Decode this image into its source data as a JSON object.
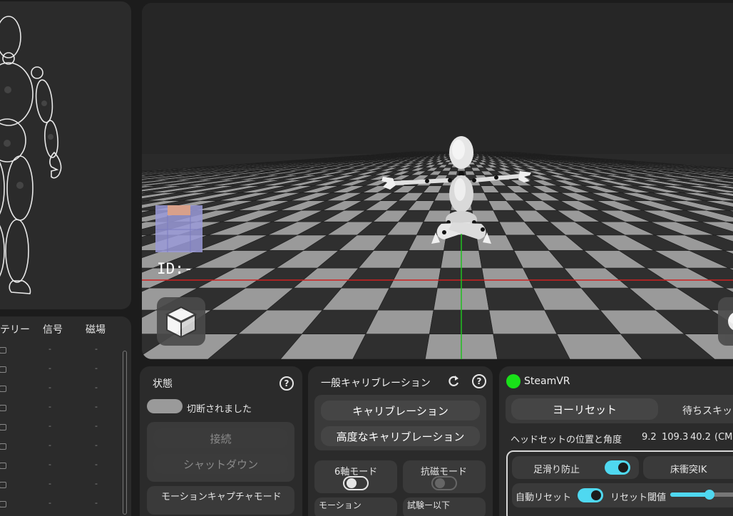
{
  "viewport": {
    "id_label": "ID:-",
    "grid_dark": "#2f2f2f",
    "grid_light": "#9a9a9a",
    "x_axis_color": "#d02020",
    "z_axis_color": "#20c020"
  },
  "sensor_table": {
    "headers": [
      "テリー",
      "信号",
      "磁場"
    ],
    "rows": [
      {
        "signal": "-",
        "field": "-"
      },
      {
        "signal": "-",
        "field": "-"
      },
      {
        "signal": "-",
        "field": "-"
      },
      {
        "signal": "-",
        "field": "-"
      },
      {
        "signal": "-",
        "field": "-"
      },
      {
        "signal": "-",
        "field": "-"
      },
      {
        "signal": "-",
        "field": "-"
      },
      {
        "signal": "-",
        "field": "-"
      },
      {
        "signal": "-",
        "field": "-"
      }
    ]
  },
  "status_panel": {
    "title": "状態",
    "help": "?",
    "connection_status": "切断されました",
    "connect_button": "接続",
    "shutdown_button": "シャットダウン",
    "mocap_mode_label": "モーションキャプチャモード"
  },
  "calibration_panel": {
    "title": "一般キャリブレーション",
    "help": "?",
    "calibration_button": "キャリブレーション",
    "advanced_button": "高度なキャリブレーション",
    "six_axis_label": "6軸モード",
    "anti_magnetic_label": "抗磁モード",
    "partial_label_1": "モーション",
    "partial_label_2": "試験ー以下"
  },
  "steamvr_panel": {
    "title": "SteamVR",
    "status_color": "#19e019",
    "yaw_reset_button": "ヨーリセット",
    "wait_skip_button": "待ちスキップ",
    "headset_label": "ヘッドセットの位置と角度",
    "headset_x": "9.2",
    "headset_y": "109.3",
    "headset_z": "40.2",
    "headset_unit": "(CM)",
    "foot_slide_label": "足滑り防止",
    "floor_ik_label": "床衝突IK",
    "auto_reset_label": "自動リセット",
    "reset_threshold_label": "リセット閾値",
    "accent_color": "#4fd8f0",
    "foot_slide_on": true,
    "auto_reset_on": true,
    "threshold_fraction": 0.55
  }
}
